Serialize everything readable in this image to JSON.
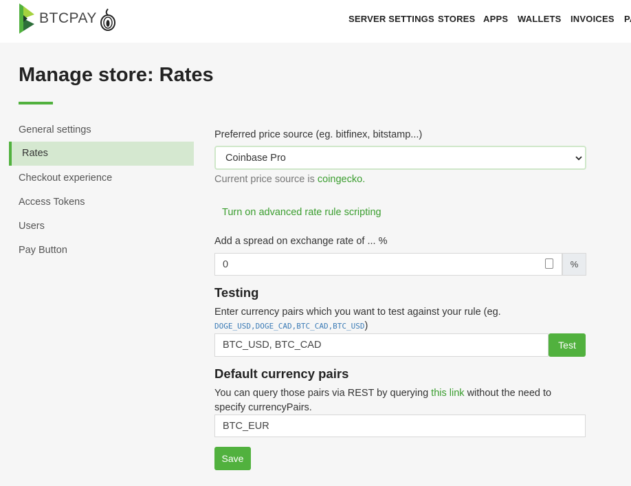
{
  "header": {
    "brand": "BTCPAY",
    "nav": [
      "SERVER SETTINGS",
      "STORES",
      "APPS",
      "WALLETS",
      "INVOICES",
      "PA"
    ]
  },
  "page": {
    "title": "Manage store: Rates"
  },
  "sidebar": {
    "items": [
      {
        "label": "General settings",
        "active": false
      },
      {
        "label": "Rates",
        "active": true
      },
      {
        "label": "Checkout experience",
        "active": false
      },
      {
        "label": "Access Tokens",
        "active": false
      },
      {
        "label": "Users",
        "active": false
      },
      {
        "label": "Pay Button",
        "active": false
      }
    ]
  },
  "form": {
    "price_source_label": "Preferred price source (eg. bitfinex, bitstamp...)",
    "price_source_value": "Coinbase Pro",
    "current_source_prefix": "Current price source is",
    "current_source_value": "coingecko",
    "current_source_suffix": ".",
    "advanced_link": "Turn on advanced rate rule scripting",
    "spread_label": "Add a spread on exchange rate of ... %",
    "spread_value": "0",
    "spread_unit": "%"
  },
  "testing": {
    "heading": "Testing",
    "desc": "Enter currency pairs which you want to test against your rule (eg.",
    "example_code": "DOGE_USD,DOGE_CAD,BTC_CAD,BTC_USD",
    "example_close": ")",
    "input_value": "BTC_USD, BTC_CAD",
    "button": "Test"
  },
  "defaults": {
    "heading": "Default currency pairs",
    "desc_before": "You can query those pairs via REST by querying",
    "desc_link": "this link",
    "desc_after": "without the need to",
    "desc_line2": "specify currencyPairs.",
    "input_value": "BTC_EUR",
    "save_button": "Save"
  },
  "colors": {
    "accent": "#51b13e",
    "link": "#3a9d2e",
    "code": "#3b7bb6"
  }
}
